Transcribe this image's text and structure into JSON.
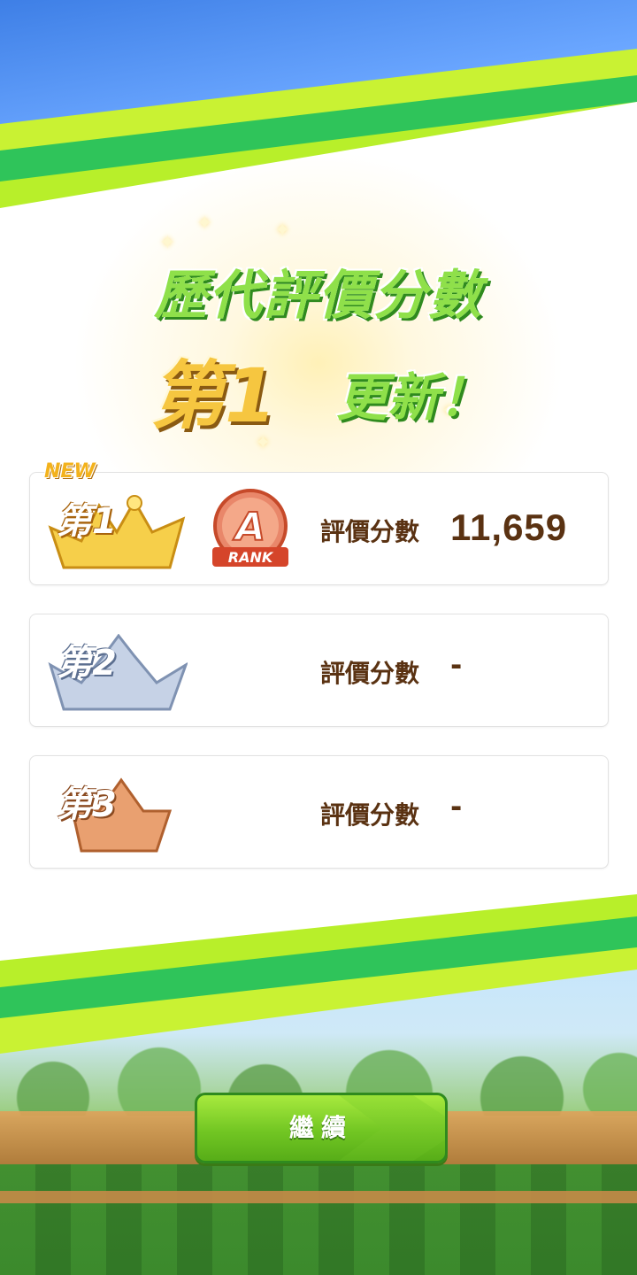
{
  "headline": {
    "title": "歷代評價分數",
    "rank": "第1",
    "updated": "更新！"
  },
  "cards": [
    {
      "rank_label": "第1",
      "new_tag": "NEW",
      "rank_badge_letter": "A",
      "rank_badge_text": "RANK",
      "score_label": "評價分數",
      "score_value": "11,659",
      "crown_color": "#f2c230"
    },
    {
      "rank_label": "第2",
      "score_label": "評價分數",
      "score_value": "-",
      "crown_color": "#9fb2d0"
    },
    {
      "rank_label": "第3",
      "score_label": "評價分數",
      "score_value": "-",
      "crown_color": "#d98a52"
    }
  ],
  "button": {
    "label": "繼續"
  },
  "colors": {
    "accent_green": "#72c623",
    "text_brown": "#5a3212",
    "stripe_green": "#2fc45a",
    "stripe_lime": "#b8ef2a"
  }
}
